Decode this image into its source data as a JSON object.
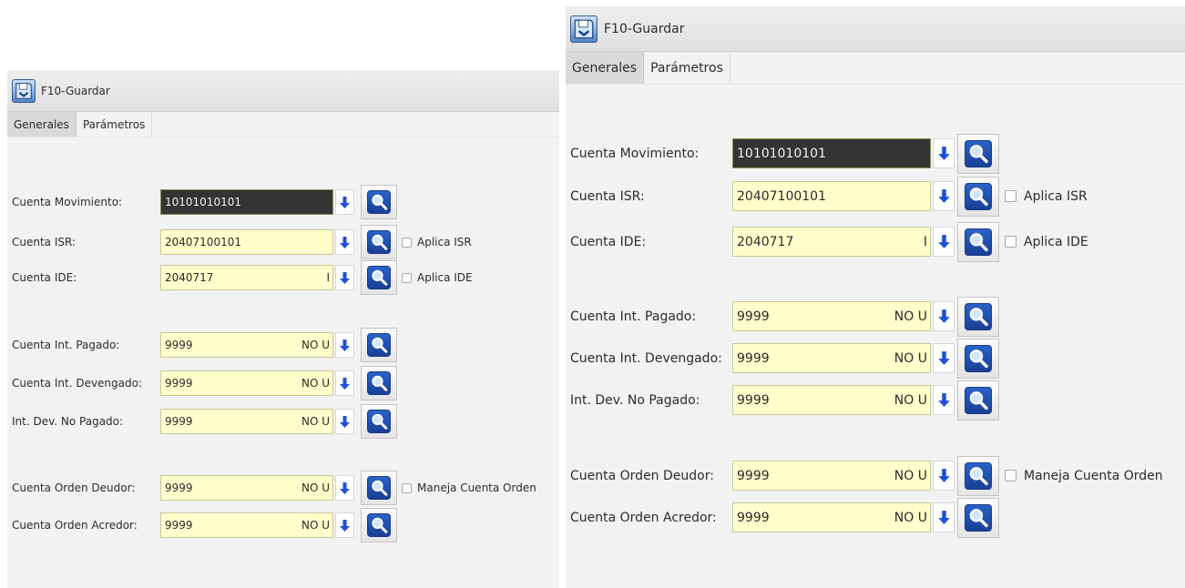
{
  "icons": {
    "save": "save-disk-icon",
    "arrow": "arrow-down-icon",
    "search": "magnifier-icon"
  },
  "colors": {
    "field_bg": "#ffffcc",
    "field_active_bg": "#343434",
    "arrow_blue": "#1e4fd8",
    "panel_bg": "#f2f2f2"
  },
  "left_panel": {
    "toolbar": {
      "save_label": "F10-Guardar"
    },
    "tabs": [
      {
        "label": "Generales",
        "active": false
      },
      {
        "label": "Parámetros",
        "active": true
      }
    ],
    "rows": [
      {
        "label": "Cuenta Movimiento:",
        "value": "10101010101",
        "suffix": "",
        "active": true,
        "checkbox": ""
      },
      {
        "label": "Cuenta ISR:",
        "value": "20407100101",
        "suffix": "",
        "active": false,
        "checkbox": "Aplica ISR"
      },
      {
        "label": "Cuenta IDE:",
        "value": "2040717",
        "suffix": "I",
        "active": false,
        "checkbox": "Aplica IDE"
      },
      {
        "label": "Cuenta Int. Pagado:",
        "value": "9999",
        "suffix": "NO U",
        "active": false,
        "checkbox": ""
      },
      {
        "label": "Cuenta Int. Devengado:",
        "value": "9999",
        "suffix": "NO U",
        "active": false,
        "checkbox": ""
      },
      {
        "label": "Int. Dev. No Pagado:",
        "value": "9999",
        "suffix": "NO U",
        "active": false,
        "checkbox": ""
      },
      {
        "label": "Cuenta Orden Deudor:",
        "value": "9999",
        "suffix": "NO U",
        "active": false,
        "checkbox": "Maneja Cuenta Orden"
      },
      {
        "label": "Cuenta Orden Acredor:",
        "value": "9999",
        "suffix": "NO U",
        "active": false,
        "checkbox": ""
      }
    ]
  },
  "right_panel": {
    "toolbar": {
      "save_label": "F10-Guardar"
    },
    "tabs": [
      {
        "label": "Generales",
        "active": false
      },
      {
        "label": "Parámetros",
        "active": true
      }
    ],
    "rows": [
      {
        "label": "Cuenta Movimiento:",
        "value": "10101010101",
        "suffix": "",
        "active": true,
        "checkbox": ""
      },
      {
        "label": "Cuenta ISR:",
        "value": "20407100101",
        "suffix": "",
        "active": false,
        "checkbox": "Aplica ISR"
      },
      {
        "label": "Cuenta IDE:",
        "value": "2040717",
        "suffix": "I",
        "active": false,
        "checkbox": "Aplica IDE"
      },
      {
        "label": "Cuenta Int. Pagado:",
        "value": "9999",
        "suffix": "NO U",
        "active": false,
        "checkbox": ""
      },
      {
        "label": "Cuenta Int. Devengado:",
        "value": "9999",
        "suffix": "NO U",
        "active": false,
        "checkbox": ""
      },
      {
        "label": "Int. Dev. No Pagado:",
        "value": "9999",
        "suffix": "NO U",
        "active": false,
        "checkbox": ""
      },
      {
        "label": "Cuenta Orden Deudor:",
        "value": "9999",
        "suffix": "NO U",
        "active": false,
        "checkbox": "Maneja Cuenta Orden"
      },
      {
        "label": "Cuenta Orden Acredor:",
        "value": "9999",
        "suffix": "NO U",
        "active": false,
        "checkbox": ""
      }
    ]
  }
}
